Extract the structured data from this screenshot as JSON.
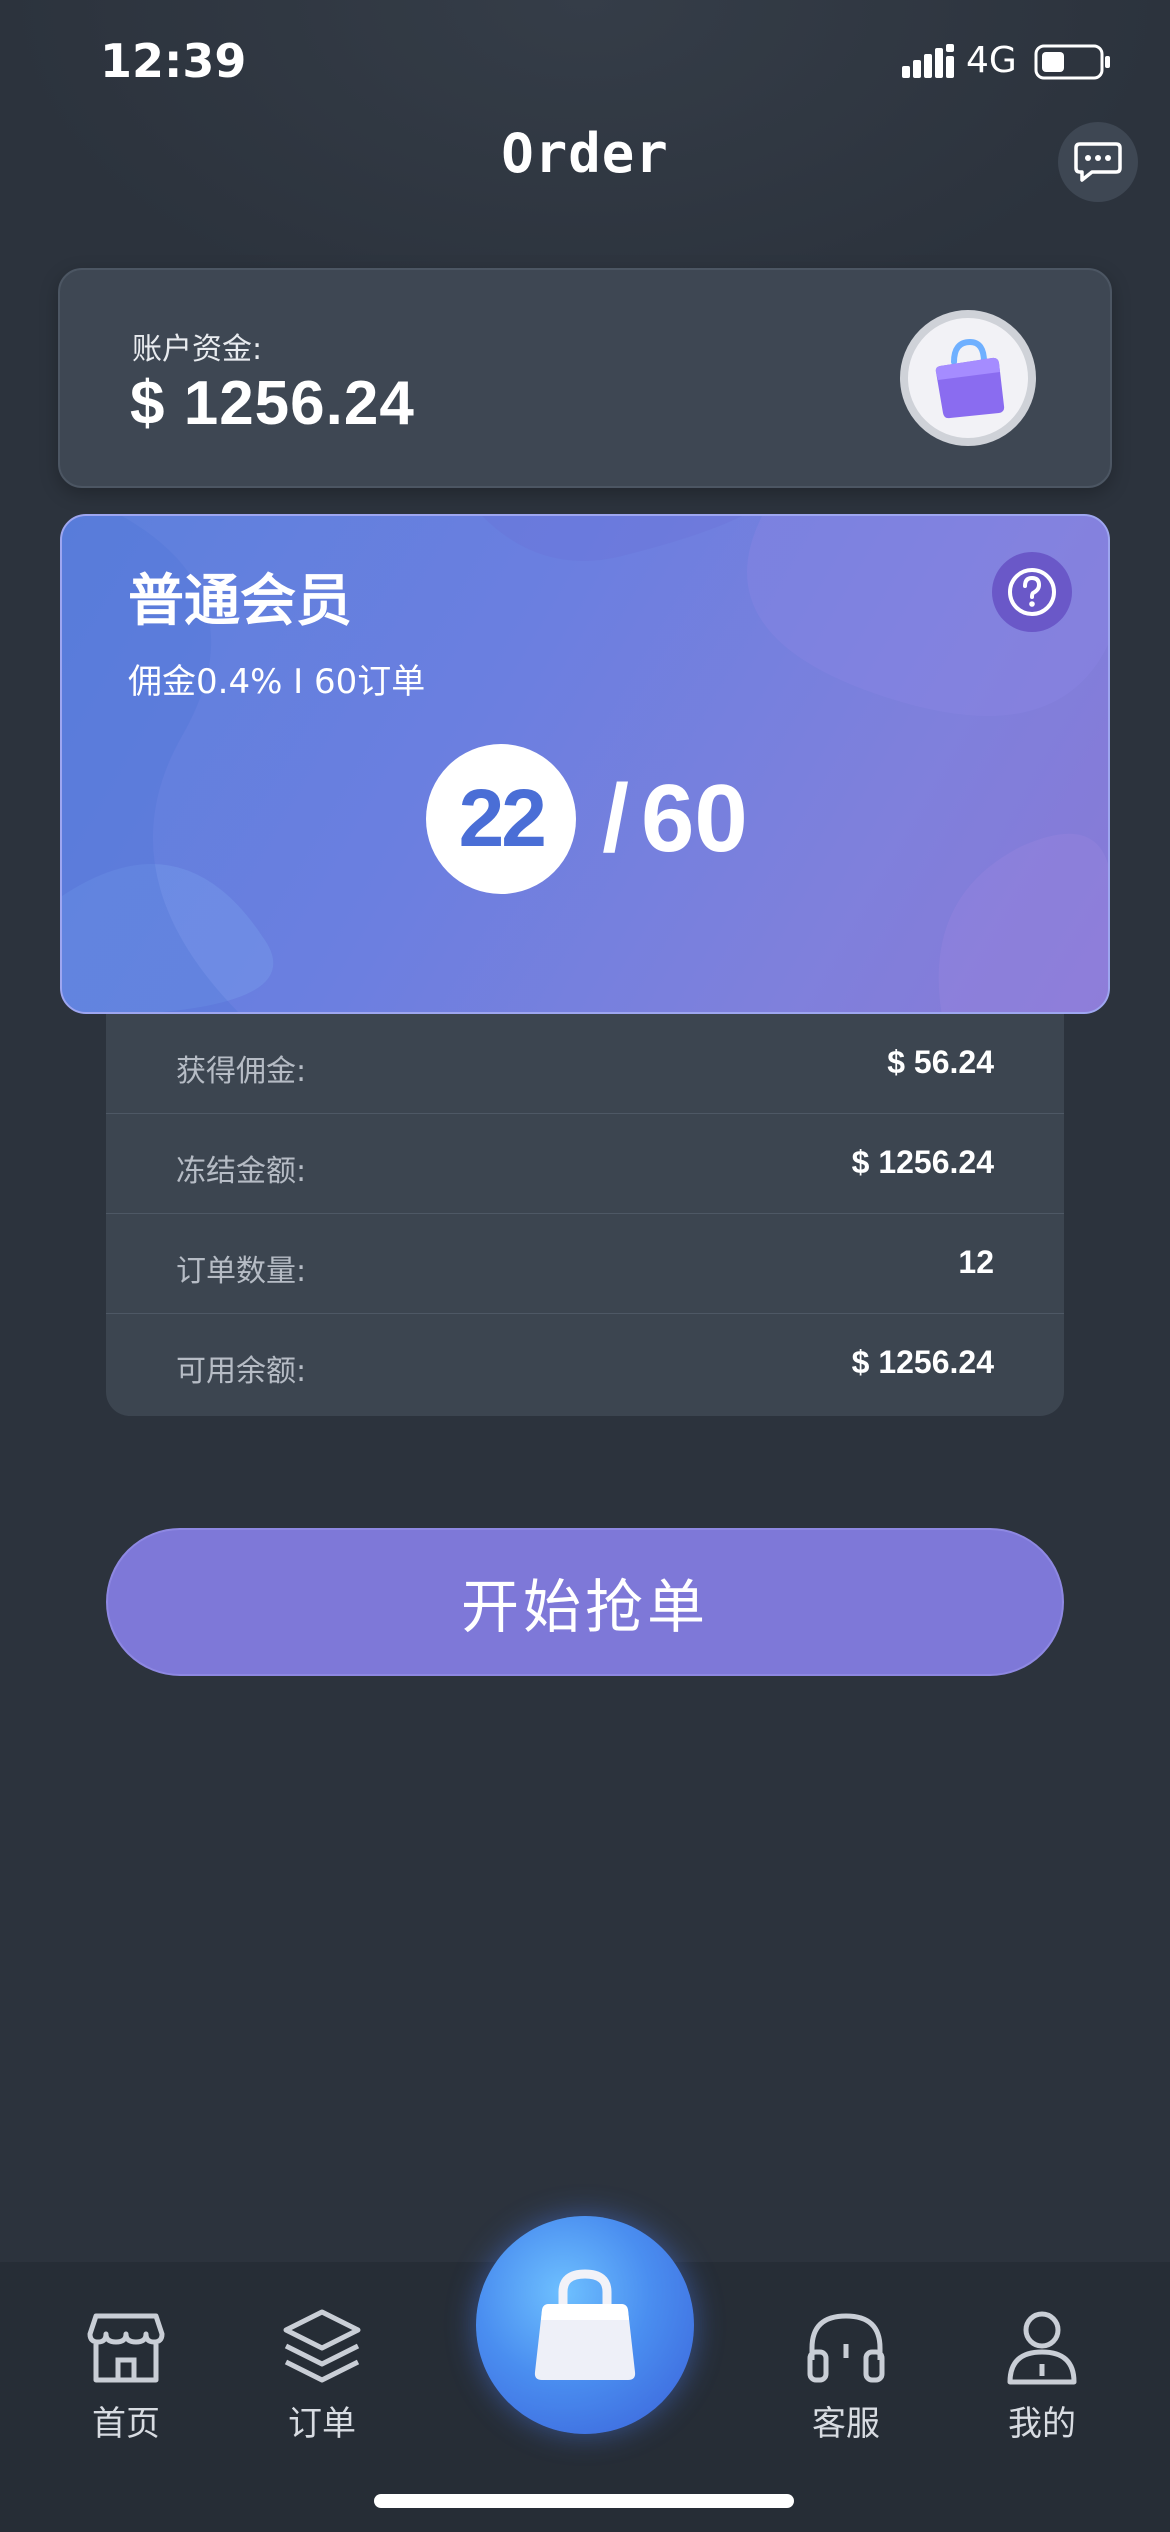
{
  "status_bar": {
    "time": "12:39",
    "network": "4G"
  },
  "header": {
    "title": "Order"
  },
  "balance": {
    "label": "账户资金:",
    "value": "$ 1256.24"
  },
  "member": {
    "title": "普通会员",
    "subtitle": "佣金0.4% I 60订单",
    "progress_current": "22",
    "progress_separator": "/",
    "progress_total": "60"
  },
  "stats": [
    {
      "label": "获得佣金:",
      "value": "$ 56.24"
    },
    {
      "label": "冻结金额:",
      "value": "$ 1256.24"
    },
    {
      "label": "订单数量:",
      "value": "12"
    },
    {
      "label": "可用余额:",
      "value": "$ 1256.24"
    }
  ],
  "start_button": {
    "label": "开始抢单"
  },
  "tab_bar": {
    "items": [
      {
        "label": "首页",
        "icon": "store-icon"
      },
      {
        "label": "订单",
        "icon": "layers-icon"
      },
      {
        "label": "",
        "icon": "shopping-bag-icon"
      },
      {
        "label": "客服",
        "icon": "headset-icon"
      },
      {
        "label": "我的",
        "icon": "user-icon"
      }
    ]
  },
  "colors": {
    "background": "#2c333d",
    "card": "#3e4753",
    "accent": "#7e78d8",
    "member_gradient_start": "#5d80dc",
    "member_gradient_end": "#8879d6"
  }
}
